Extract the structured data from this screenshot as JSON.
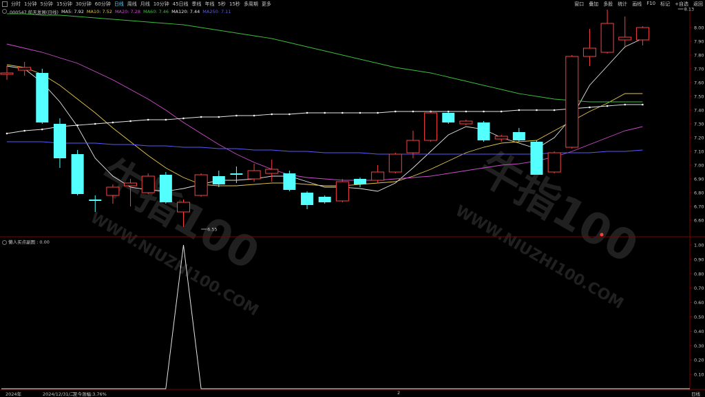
{
  "toolbar": {
    "periods": [
      "分时",
      "1分钟",
      "5分钟",
      "15分钟",
      "30分钟",
      "60分钟",
      "日线",
      "周线",
      "月线",
      "10分钟",
      "45日线",
      "季线",
      "年线",
      "5秒",
      "15秒",
      "多周期",
      "更多"
    ],
    "active": "日线",
    "right_items": [
      "窗口",
      "叠加",
      "多股",
      "统计",
      "画线",
      "F10",
      "标记",
      "+自选",
      "返回"
    ]
  },
  "legend": {
    "stock": "000547 航天发展(日线)",
    "ma": [
      {
        "label": "MA5: 7.92",
        "color": "#e6e6e6"
      },
      {
        "label": "MA10: 7.52",
        "color": "#e6c84a"
      },
      {
        "label": "MA20: 7.28",
        "color": "#d24cd2"
      },
      {
        "label": "MA60: 7.46",
        "color": "#3cbf3c"
      },
      {
        "label": "MA120: 7.44",
        "color": "#e6e6e6"
      },
      {
        "label": "MA250: 7.11",
        "color": "#5a5aff"
      }
    ]
  },
  "indicator": {
    "label": "懒人买点副图 : 0.00"
  },
  "bottom": {
    "year": "2024年",
    "date": "2024/12/31/二",
    "gain": "至今涨幅:3.76%",
    "mid": "2",
    "right": "日线"
  },
  "watermark": {
    "text": "牛指100",
    "url": "WWW.NIUZHI100.COM"
  },
  "colors": {
    "up": "#ff4040",
    "down": "#54ffff",
    "bg": "#000000",
    "grid": "#3a0000",
    "axis": "#800000"
  },
  "chart_data": [
    {
      "type": "candlestick",
      "title": "",
      "ylim": [
        6.5,
        8.1
      ],
      "y_ticks": [
        "8.00",
        "7.90",
        "7.80",
        "7.70",
        "7.60",
        "7.50",
        "7.40",
        "7.30",
        "7.20",
        "7.10",
        "7.00",
        "6.90",
        "6.80",
        "6.70",
        "6.60"
      ],
      "annotations": [
        {
          "text": "8.13",
          "x_index": 38,
          "value": 8.13
        },
        {
          "text": "6.55",
          "x_index": 11,
          "value": 6.55
        }
      ],
      "candles": [
        {
          "o": 7.66,
          "c": 7.67,
          "h": 7.72,
          "l": 7.62
        },
        {
          "o": 7.69,
          "c": 7.71,
          "h": 7.75,
          "l": 7.65
        },
        {
          "o": 7.67,
          "c": 7.31,
          "h": 7.7,
          "l": 7.3
        },
        {
          "o": 7.3,
          "c": 7.05,
          "h": 7.34,
          "l": 6.98
        },
        {
          "o": 7.08,
          "c": 6.79,
          "h": 7.11,
          "l": 6.78
        },
        {
          "o": 6.75,
          "c": 6.74,
          "h": 6.78,
          "l": 6.66
        },
        {
          "o": 6.78,
          "c": 6.84,
          "h": 6.86,
          "l": 6.72
        },
        {
          "o": 6.85,
          "c": 6.87,
          "h": 6.9,
          "l": 6.7
        },
        {
          "o": 6.8,
          "c": 6.92,
          "h": 6.94,
          "l": 6.79
        },
        {
          "o": 6.93,
          "c": 6.73,
          "h": 6.95,
          "l": 6.72
        },
        {
          "o": 6.66,
          "c": 6.73,
          "h": 6.75,
          "l": 6.55
        },
        {
          "o": 6.78,
          "c": 6.93,
          "h": 6.94,
          "l": 6.77
        },
        {
          "o": 6.92,
          "c": 6.86,
          "h": 6.96,
          "l": 6.84
        },
        {
          "o": 6.94,
          "c": 6.93,
          "h": 6.99,
          "l": 6.87
        },
        {
          "o": 6.9,
          "c": 6.96,
          "h": 7.01,
          "l": 6.88
        },
        {
          "o": 6.94,
          "c": 6.97,
          "h": 7.04,
          "l": 6.88
        },
        {
          "o": 6.94,
          "c": 6.82,
          "h": 6.96,
          "l": 6.81
        },
        {
          "o": 6.8,
          "c": 6.71,
          "h": 6.81,
          "l": 6.68
        },
        {
          "o": 6.77,
          "c": 6.73,
          "h": 6.78,
          "l": 6.72
        },
        {
          "o": 6.74,
          "c": 6.88,
          "h": 6.9,
          "l": 6.73
        },
        {
          "o": 6.9,
          "c": 6.86,
          "h": 6.91,
          "l": 6.84
        },
        {
          "o": 6.89,
          "c": 6.95,
          "h": 7.0,
          "l": 6.87
        },
        {
          "o": 6.95,
          "c": 7.08,
          "h": 7.09,
          "l": 6.94
        },
        {
          "o": 7.09,
          "c": 7.18,
          "h": 7.25,
          "l": 7.05
        },
        {
          "o": 7.18,
          "c": 7.38,
          "h": 7.39,
          "l": 7.17
        },
        {
          "o": 7.38,
          "c": 7.31,
          "h": 7.39,
          "l": 7.3
        },
        {
          "o": 7.3,
          "c": 7.32,
          "h": 7.33,
          "l": 7.29
        },
        {
          "o": 7.31,
          "c": 7.18,
          "h": 7.32,
          "l": 7.17
        },
        {
          "o": 7.19,
          "c": 7.21,
          "h": 7.22,
          "l": 7.17
        },
        {
          "o": 7.24,
          "c": 7.18,
          "h": 7.27,
          "l": 7.17
        },
        {
          "o": 7.17,
          "c": 6.93,
          "h": 7.18,
          "l": 6.93
        },
        {
          "o": 6.95,
          "c": 7.09,
          "h": 7.1,
          "l": 6.94
        },
        {
          "o": 7.13,
          "c": 7.79,
          "h": 7.8,
          "l": 7.12
        },
        {
          "o": 7.79,
          "c": 7.85,
          "h": 7.99,
          "l": 7.72
        },
        {
          "o": 7.82,
          "c": 8.03,
          "h": 8.13,
          "l": 7.81
        },
        {
          "o": 7.91,
          "c": 7.93,
          "h": 8.08,
          "l": 7.85
        },
        {
          "o": 7.91,
          "c": 8.0,
          "h": 8.01,
          "l": 7.87
        }
      ],
      "series": [
        {
          "name": "MA5",
          "color": "#e6e6e6",
          "values": [
            7.72,
            7.7,
            7.6,
            7.46,
            7.28,
            7.05,
            6.92,
            6.84,
            6.82,
            6.81,
            6.83,
            6.86,
            6.89,
            6.89,
            6.9,
            6.92,
            6.92,
            6.88,
            6.84,
            6.84,
            6.83,
            6.81,
            6.87,
            6.98,
            7.1,
            7.22,
            7.28,
            7.26,
            7.2,
            7.16,
            7.12,
            7.2,
            7.35,
            7.58,
            7.72,
            7.86,
            7.92
          ]
        },
        {
          "name": "MA10",
          "color": "#e6c84a",
          "values": [
            7.73,
            7.71,
            7.66,
            7.58,
            7.48,
            7.38,
            7.27,
            7.17,
            7.07,
            6.98,
            6.91,
            6.86,
            6.85,
            6.85,
            6.86,
            6.87,
            6.87,
            6.86,
            6.85,
            6.85,
            6.86,
            6.87,
            6.88,
            6.92,
            6.97,
            7.03,
            7.09,
            7.13,
            7.16,
            7.17,
            7.18,
            7.25,
            7.32,
            7.39,
            7.45,
            7.52,
            7.52
          ]
        },
        {
          "name": "MA20",
          "color": "#d24cd2",
          "values": [
            7.88,
            7.85,
            7.82,
            7.78,
            7.74,
            7.68,
            7.62,
            7.55,
            7.48,
            7.4,
            7.31,
            7.23,
            7.15,
            7.08,
            7.02,
            6.97,
            6.93,
            6.91,
            6.9,
            6.89,
            6.89,
            6.89,
            6.9,
            6.91,
            6.92,
            6.94,
            6.96,
            6.98,
            7.0,
            7.01,
            7.03,
            7.06,
            7.1,
            7.15,
            7.2,
            7.25,
            7.28
          ]
        },
        {
          "name": "MA60",
          "color": "#3cbf3c",
          "values": [
            8.1,
            8.1,
            8.09,
            8.09,
            8.08,
            8.07,
            8.06,
            8.05,
            8.04,
            8.03,
            8.02,
            8.0,
            7.98,
            7.96,
            7.94,
            7.92,
            7.89,
            7.86,
            7.83,
            7.8,
            7.77,
            7.74,
            7.71,
            7.69,
            7.67,
            7.64,
            7.61,
            7.58,
            7.55,
            7.52,
            7.5,
            7.48,
            7.47,
            7.46,
            7.46,
            7.46,
            7.46
          ]
        },
        {
          "name": "MA120",
          "color": "#e6e6e6",
          "values": [
            7.23,
            7.25,
            7.26,
            7.28,
            7.29,
            7.3,
            7.31,
            7.32,
            7.33,
            7.33,
            7.34,
            7.35,
            7.35,
            7.36,
            7.36,
            7.37,
            7.37,
            7.38,
            7.38,
            7.38,
            7.38,
            7.38,
            7.39,
            7.39,
            7.39,
            7.39,
            7.39,
            7.39,
            7.39,
            7.4,
            7.4,
            7.4,
            7.41,
            7.42,
            7.43,
            7.44,
            7.44
          ]
        },
        {
          "name": "MA250",
          "color": "#5a5aff",
          "values": [
            7.17,
            7.17,
            7.17,
            7.16,
            7.16,
            7.16,
            7.15,
            7.15,
            7.14,
            7.14,
            7.13,
            7.13,
            7.12,
            7.12,
            7.11,
            7.11,
            7.1,
            7.1,
            7.09,
            7.09,
            7.09,
            7.08,
            7.08,
            7.08,
            7.08,
            7.08,
            7.08,
            7.08,
            7.08,
            7.08,
            7.08,
            7.09,
            7.09,
            7.09,
            7.1,
            7.1,
            7.11
          ]
        }
      ]
    },
    {
      "type": "line",
      "title": "懒人买点副图",
      "ylim": [
        0,
        1
      ],
      "y_ticks": [
        "1.00",
        "0.90",
        "0.80",
        "0.70",
        "0.60",
        "0.50",
        "0.40",
        "0.30",
        "0.20",
        "0.10"
      ],
      "series": [
        {
          "name": "懒人买点副图",
          "color": "#e6e6e6",
          "values": [
            0,
            0,
            0,
            0,
            0,
            0,
            0,
            0,
            0,
            0,
            1,
            0,
            0,
            0,
            0,
            0,
            0,
            0,
            0,
            0,
            0,
            0,
            0,
            0,
            0,
            0,
            0,
            0,
            0,
            0,
            0,
            0,
            0,
            0,
            0,
            0,
            0
          ]
        }
      ]
    }
  ]
}
